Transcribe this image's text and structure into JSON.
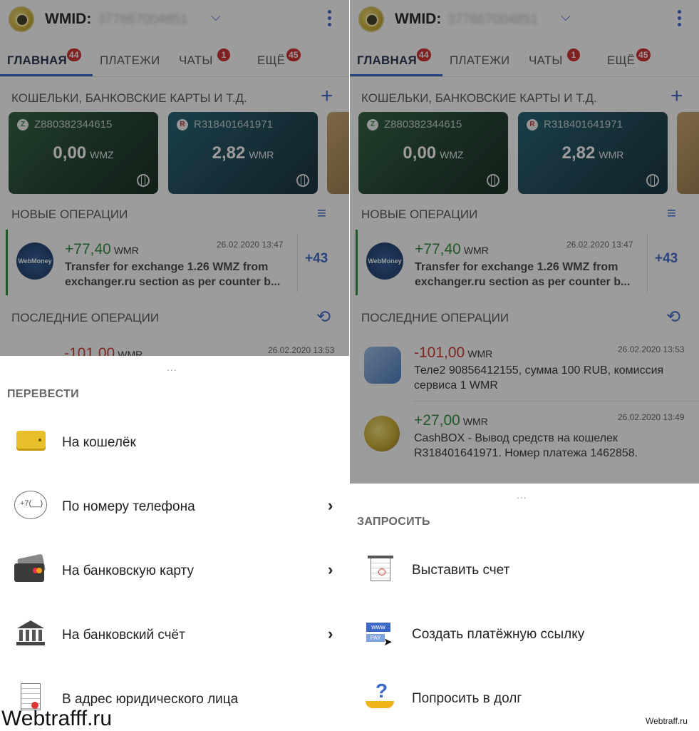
{
  "header": {
    "wmid_label": "WMID:",
    "wmid_value": "377667004851"
  },
  "tabs": [
    {
      "label": "ГЛАВНАЯ",
      "badge": "44"
    },
    {
      "label": "ПЛАТЕЖИ",
      "badge": ""
    },
    {
      "label": "ЧАТЫ",
      "badge": "1"
    },
    {
      "label": "ЕЩЁ",
      "badge": "45"
    }
  ],
  "wallets_section": {
    "title": "КОШЕЛЬКИ, БАНКОВСКИЕ КАРТЫ И Т.Д.",
    "add_icon": "plus-icon"
  },
  "wallets": [
    {
      "number": "Z880382344615",
      "balance": "0,00",
      "currency": "WMZ",
      "color": "#1f4a30"
    },
    {
      "number": "R318401641971",
      "balance": "2,82",
      "currency": "WMR",
      "color": "#18495a"
    }
  ],
  "new_ops": {
    "title": "НОВЫЕ ОПЕРАЦИИ",
    "item": {
      "amount": "+77,40",
      "currency": "WMR",
      "date": "26.02.2020 13:47",
      "desc_line1": "Transfer for exchange 1.26 WMZ from",
      "desc_line2": "exchanger.ru section as per counter b...",
      "avatar_text": "WebMoney exchanger"
    },
    "more": "+43"
  },
  "last_ops": {
    "title": "ПОСЛЕДНИЕ ОПЕРАЦИИ",
    "items": [
      {
        "amount": "-101,00",
        "currency": "WMR",
        "date": "26.02.2020 13:53",
        "desc_line1": "Теле2 90856412155, сумма 100 RUB, комиссия",
        "desc_line2": "сервиса 1 WMR"
      },
      {
        "amount": "+27,00",
        "currency": "WMR",
        "date": "26.02.2020 13:49",
        "desc_line1": "CashBOX - Вывод средств на кошелек",
        "desc_line2": "R318401641971. Номер платежа 1462858."
      }
    ]
  },
  "grip": "...",
  "transfer_sheet": {
    "title": "ПЕРЕВЕСТИ",
    "items": [
      {
        "label": "На кошелёк",
        "icon": "wallet-icon",
        "chevron": ""
      },
      {
        "label": "По номеру телефона",
        "icon": "phone-number-icon",
        "chevron": "›",
        "icon_text": "+7(__)"
      },
      {
        "label": "На банковскую карту",
        "icon": "bank-card-icon",
        "chevron": "›"
      },
      {
        "label": "На банковский счёт",
        "icon": "bank-building-icon",
        "chevron": "›"
      },
      {
        "label": "В адрес юридического лица",
        "icon": "document-icon",
        "chevron": ""
      }
    ]
  },
  "request_sheet": {
    "title": "ЗАПРОСИТЬ",
    "items": [
      {
        "label": "Выставить счет",
        "icon": "invoice-icon"
      },
      {
        "label": "Создать платёжную ссылку",
        "icon": "payment-link-icon",
        "icon_text_top": "www",
        "icon_text_bottom": "PAY"
      },
      {
        "label": "Попросить в долг",
        "icon": "loan-request-icon",
        "icon_text": "?"
      }
    ]
  },
  "watermarks": {
    "left": "Webtrafff.ru",
    "right": "Webtraff.ru"
  }
}
